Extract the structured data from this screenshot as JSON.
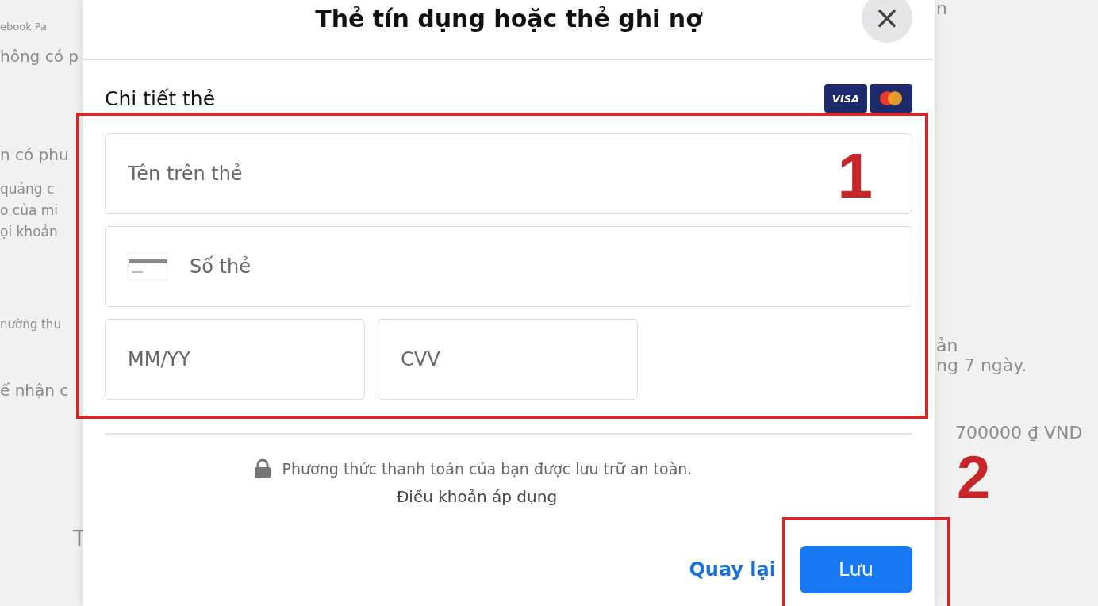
{
  "background": {
    "left_texts": [
      "ebook Pa",
      "hông có p",
      "n có phu",
      "quảng c",
      "o của mi",
      "ọi khoản",
      "nường thu",
      "ế nhận c",
      "T"
    ],
    "right_texts": [
      "n",
      "ản",
      "ng 7 ngày.",
      "700000 ₫ VND"
    ]
  },
  "dialog": {
    "title": "Thẻ tín dụng hoặc thẻ ghi nợ",
    "close": "×",
    "section": "Chi tiết thẻ",
    "card_brands": [
      {
        "kind": "visa",
        "label": "VISA"
      },
      {
        "kind": "mastercard"
      }
    ],
    "fields": [
      {
        "kind": "name",
        "placeholder": "Tên trên thẻ"
      },
      {
        "kind": "number",
        "placeholder": "Số thẻ"
      },
      {
        "kind": "expiry",
        "placeholder": "MM/YY"
      },
      {
        "kind": "cvv",
        "placeholder": "CVV"
      }
    ],
    "secure_note": "Phương thức thanh toán của bạn được lưu trữ an toàn.",
    "terms_link": "Điều khoản áp dụng",
    "back_button": "Quay lại",
    "save_button": "Lưu"
  },
  "annotations": [
    {
      "label": "1"
    },
    {
      "label": "2"
    }
  ]
}
